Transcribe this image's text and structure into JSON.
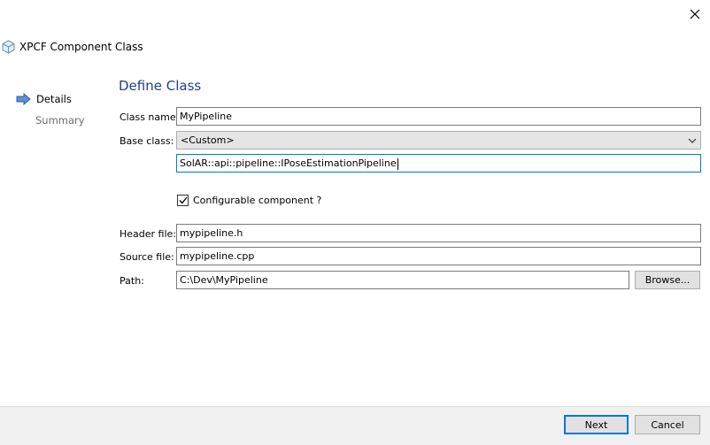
{
  "window": {
    "title": "XPCF Component Class"
  },
  "steps": [
    {
      "label": "Details",
      "active": true
    },
    {
      "label": "Summary",
      "active": false
    }
  ],
  "section_title": "Define Class",
  "form": {
    "class_name_label": "Class name:",
    "class_name_value": "MyPipeline",
    "base_class_label": "Base class:",
    "base_class_selected": "<Custom>",
    "custom_base_value": "SolAR::api::pipeline::IPoseEstimationPipeline",
    "configurable_label": "Configurable component ?",
    "configurable_checked": true,
    "header_file_label": "Header file:",
    "header_file_value": "mypipeline.h",
    "source_file_label": "Source file:",
    "source_file_value": "mypipeline.cpp",
    "path_label": "Path:",
    "path_value": "C:\\Dev\\MyPipeline",
    "browse_label": "Browse..."
  },
  "footer": {
    "next_label": "Next",
    "cancel_label": "Cancel"
  },
  "colors": {
    "accent": "#0078d7",
    "title_blue": "#1f3f8f",
    "arrow_blue": "#3f6fbf",
    "footer_bg": "#f0f0f0"
  }
}
